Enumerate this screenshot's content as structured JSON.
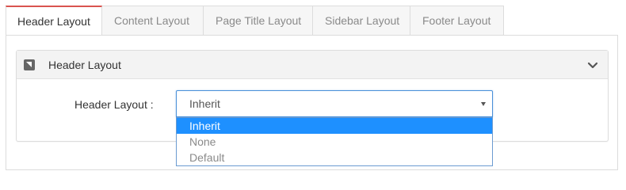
{
  "tabs": [
    {
      "label": "Header Layout",
      "active": true
    },
    {
      "label": "Content Layout",
      "active": false
    },
    {
      "label": "Page Title Layout",
      "active": false
    },
    {
      "label": "Sidebar Layout",
      "active": false
    },
    {
      "label": "Footer Layout",
      "active": false
    }
  ],
  "panel": {
    "title": "Header Layout",
    "icon": "collapse-square-icon",
    "toggle_icon": "chevron-down-icon"
  },
  "form": {
    "label": "Header Layout :",
    "select": {
      "value": "Inherit",
      "options": [
        "Inherit",
        "None",
        "Default"
      ],
      "highlighted": "Inherit"
    }
  },
  "colors": {
    "active_tab_accent": "#d9534f",
    "select_border": "#4a90d9",
    "option_highlight": "#1e90ff"
  }
}
